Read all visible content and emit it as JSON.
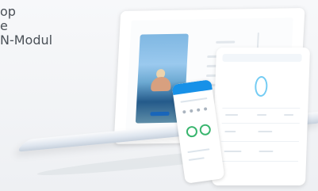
{
  "left_text": {
    "line1": "op",
    "line2": "e",
    "line3": "N-Modul"
  },
  "colors": {
    "text": "#4a5057",
    "accent": "#1791e8",
    "status_ring": "#39b56e",
    "tablet_ring": "#74ccf3"
  },
  "icons": {
    "tablet_gauge": "gauge-ring-icon",
    "phone_gauge_left": "gauge-ring-icon",
    "phone_gauge_right": "gauge-ring-icon"
  }
}
